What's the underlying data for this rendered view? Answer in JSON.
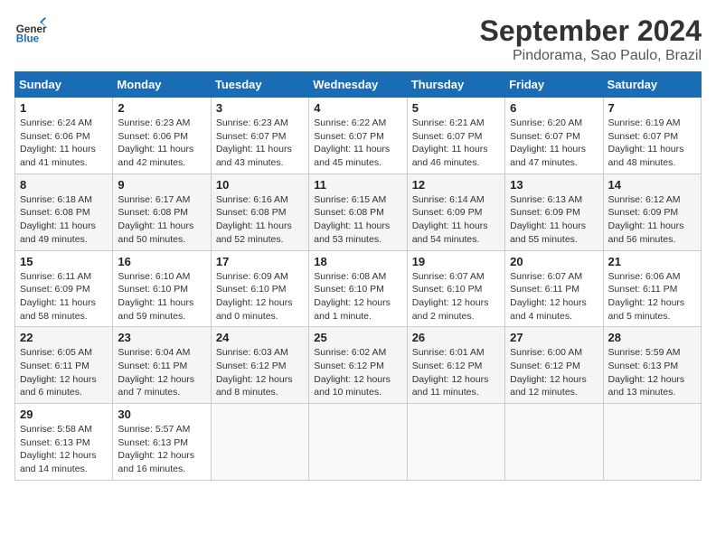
{
  "header": {
    "logo_general": "General",
    "logo_blue": "Blue",
    "month_title": "September 2024",
    "subtitle": "Pindorama, Sao Paulo, Brazil"
  },
  "calendar": {
    "days_of_week": [
      "Sunday",
      "Monday",
      "Tuesday",
      "Wednesday",
      "Thursday",
      "Friday",
      "Saturday"
    ],
    "weeks": [
      [
        {
          "day": "1",
          "sunrise": "6:24 AM",
          "sunset": "6:06 PM",
          "daylight": "11 hours and 41 minutes."
        },
        {
          "day": "2",
          "sunrise": "6:23 AM",
          "sunset": "6:06 PM",
          "daylight": "11 hours and 42 minutes."
        },
        {
          "day": "3",
          "sunrise": "6:23 AM",
          "sunset": "6:07 PM",
          "daylight": "11 hours and 43 minutes."
        },
        {
          "day": "4",
          "sunrise": "6:22 AM",
          "sunset": "6:07 PM",
          "daylight": "11 hours and 45 minutes."
        },
        {
          "day": "5",
          "sunrise": "6:21 AM",
          "sunset": "6:07 PM",
          "daylight": "11 hours and 46 minutes."
        },
        {
          "day": "6",
          "sunrise": "6:20 AM",
          "sunset": "6:07 PM",
          "daylight": "11 hours and 47 minutes."
        },
        {
          "day": "7",
          "sunrise": "6:19 AM",
          "sunset": "6:07 PM",
          "daylight": "11 hours and 48 minutes."
        }
      ],
      [
        {
          "day": "8",
          "sunrise": "6:18 AM",
          "sunset": "6:08 PM",
          "daylight": "11 hours and 49 minutes."
        },
        {
          "day": "9",
          "sunrise": "6:17 AM",
          "sunset": "6:08 PM",
          "daylight": "11 hours and 50 minutes."
        },
        {
          "day": "10",
          "sunrise": "6:16 AM",
          "sunset": "6:08 PM",
          "daylight": "11 hours and 52 minutes."
        },
        {
          "day": "11",
          "sunrise": "6:15 AM",
          "sunset": "6:08 PM",
          "daylight": "11 hours and 53 minutes."
        },
        {
          "day": "12",
          "sunrise": "6:14 AM",
          "sunset": "6:09 PM",
          "daylight": "11 hours and 54 minutes."
        },
        {
          "day": "13",
          "sunrise": "6:13 AM",
          "sunset": "6:09 PM",
          "daylight": "11 hours and 55 minutes."
        },
        {
          "day": "14",
          "sunrise": "6:12 AM",
          "sunset": "6:09 PM",
          "daylight": "11 hours and 56 minutes."
        }
      ],
      [
        {
          "day": "15",
          "sunrise": "6:11 AM",
          "sunset": "6:09 PM",
          "daylight": "11 hours and 58 minutes."
        },
        {
          "day": "16",
          "sunrise": "6:10 AM",
          "sunset": "6:10 PM",
          "daylight": "11 hours and 59 minutes."
        },
        {
          "day": "17",
          "sunrise": "6:09 AM",
          "sunset": "6:10 PM",
          "daylight": "12 hours and 0 minutes."
        },
        {
          "day": "18",
          "sunrise": "6:08 AM",
          "sunset": "6:10 PM",
          "daylight": "12 hours and 1 minute."
        },
        {
          "day": "19",
          "sunrise": "6:07 AM",
          "sunset": "6:10 PM",
          "daylight": "12 hours and 2 minutes."
        },
        {
          "day": "20",
          "sunrise": "6:07 AM",
          "sunset": "6:11 PM",
          "daylight": "12 hours and 4 minutes."
        },
        {
          "day": "21",
          "sunrise": "6:06 AM",
          "sunset": "6:11 PM",
          "daylight": "12 hours and 5 minutes."
        }
      ],
      [
        {
          "day": "22",
          "sunrise": "6:05 AM",
          "sunset": "6:11 PM",
          "daylight": "12 hours and 6 minutes."
        },
        {
          "day": "23",
          "sunrise": "6:04 AM",
          "sunset": "6:11 PM",
          "daylight": "12 hours and 7 minutes."
        },
        {
          "day": "24",
          "sunrise": "6:03 AM",
          "sunset": "6:12 PM",
          "daylight": "12 hours and 8 minutes."
        },
        {
          "day": "25",
          "sunrise": "6:02 AM",
          "sunset": "6:12 PM",
          "daylight": "12 hours and 10 minutes."
        },
        {
          "day": "26",
          "sunrise": "6:01 AM",
          "sunset": "6:12 PM",
          "daylight": "12 hours and 11 minutes."
        },
        {
          "day": "27",
          "sunrise": "6:00 AM",
          "sunset": "6:12 PM",
          "daylight": "12 hours and 12 minutes."
        },
        {
          "day": "28",
          "sunrise": "5:59 AM",
          "sunset": "6:13 PM",
          "daylight": "12 hours and 13 minutes."
        }
      ],
      [
        {
          "day": "29",
          "sunrise": "5:58 AM",
          "sunset": "6:13 PM",
          "daylight": "12 hours and 14 minutes."
        },
        {
          "day": "30",
          "sunrise": "5:57 AM",
          "sunset": "6:13 PM",
          "daylight": "12 hours and 16 minutes."
        },
        null,
        null,
        null,
        null,
        null
      ]
    ]
  }
}
